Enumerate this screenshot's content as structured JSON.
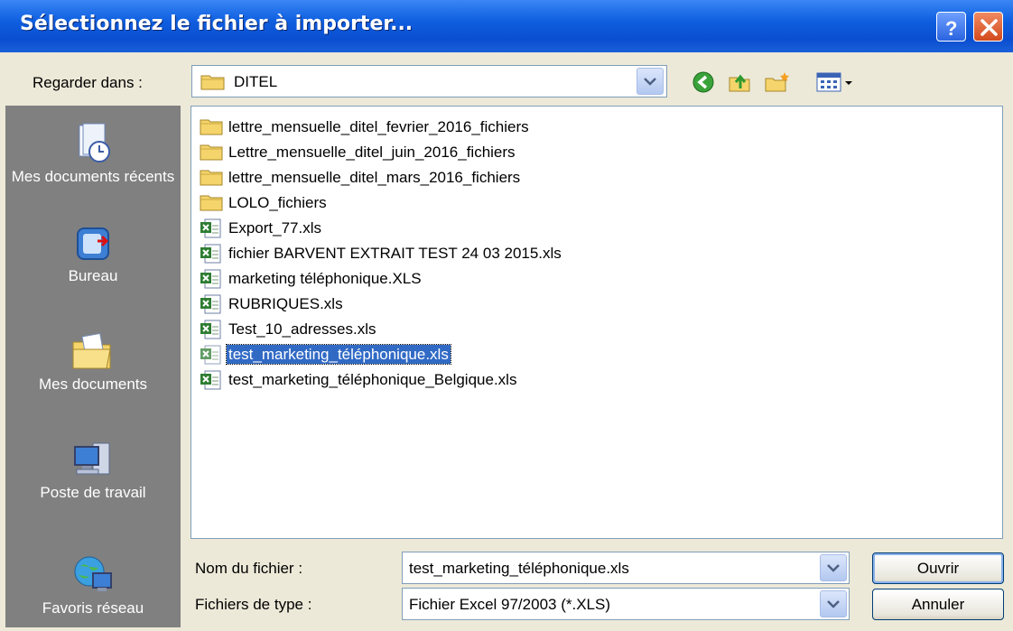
{
  "window": {
    "title": "Sélectionnez le fichier à importer..."
  },
  "look_in": {
    "label": "Regarder dans :",
    "value": "DITEL"
  },
  "places": [
    {
      "label": "Mes documents récents",
      "icon": "recent-documents-icon"
    },
    {
      "label": "Bureau",
      "icon": "desktop-icon"
    },
    {
      "label": "Mes documents",
      "icon": "my-documents-icon"
    },
    {
      "label": "Poste de travail",
      "icon": "my-computer-icon"
    },
    {
      "label": "Favoris réseau",
      "icon": "network-places-icon"
    }
  ],
  "files": [
    {
      "name": "lettre_mensuelle_ditel_fevrier_2016_fichiers",
      "type": "folder"
    },
    {
      "name": "Lettre_mensuelle_ditel_juin_2016_fichiers",
      "type": "folder"
    },
    {
      "name": "lettre_mensuelle_ditel_mars_2016_fichiers",
      "type": "folder"
    },
    {
      "name": "LOLO_fichiers",
      "type": "folder"
    },
    {
      "name": "Export_77.xls",
      "type": "xls"
    },
    {
      "name": "fichier BARVENT EXTRAIT TEST 24 03 2015.xls",
      "type": "xls"
    },
    {
      "name": "marketing téléphonique.XLS",
      "type": "xls"
    },
    {
      "name": "RUBRIQUES.xls",
      "type": "xls"
    },
    {
      "name": "Test_10_adresses.xls",
      "type": "xls"
    },
    {
      "name": "test_marketing_téléphonique.xls",
      "type": "xls",
      "selected": true
    },
    {
      "name": "test_marketing_téléphonique_Belgique.xls",
      "type": "xls"
    }
  ],
  "filename": {
    "label": "Nom du fichier :",
    "value": "test_marketing_téléphonique.xls"
  },
  "filetype": {
    "label": "Fichiers de type :",
    "value": "Fichier Excel 97/2003 (*.XLS)"
  },
  "buttons": {
    "open": "Ouvrir",
    "cancel": "Annuler"
  },
  "colors": {
    "title_bar": "#0a4ed0",
    "selection": "#316ac5",
    "places_bar": "#808080",
    "dialog_bg": "#ece9d8"
  }
}
